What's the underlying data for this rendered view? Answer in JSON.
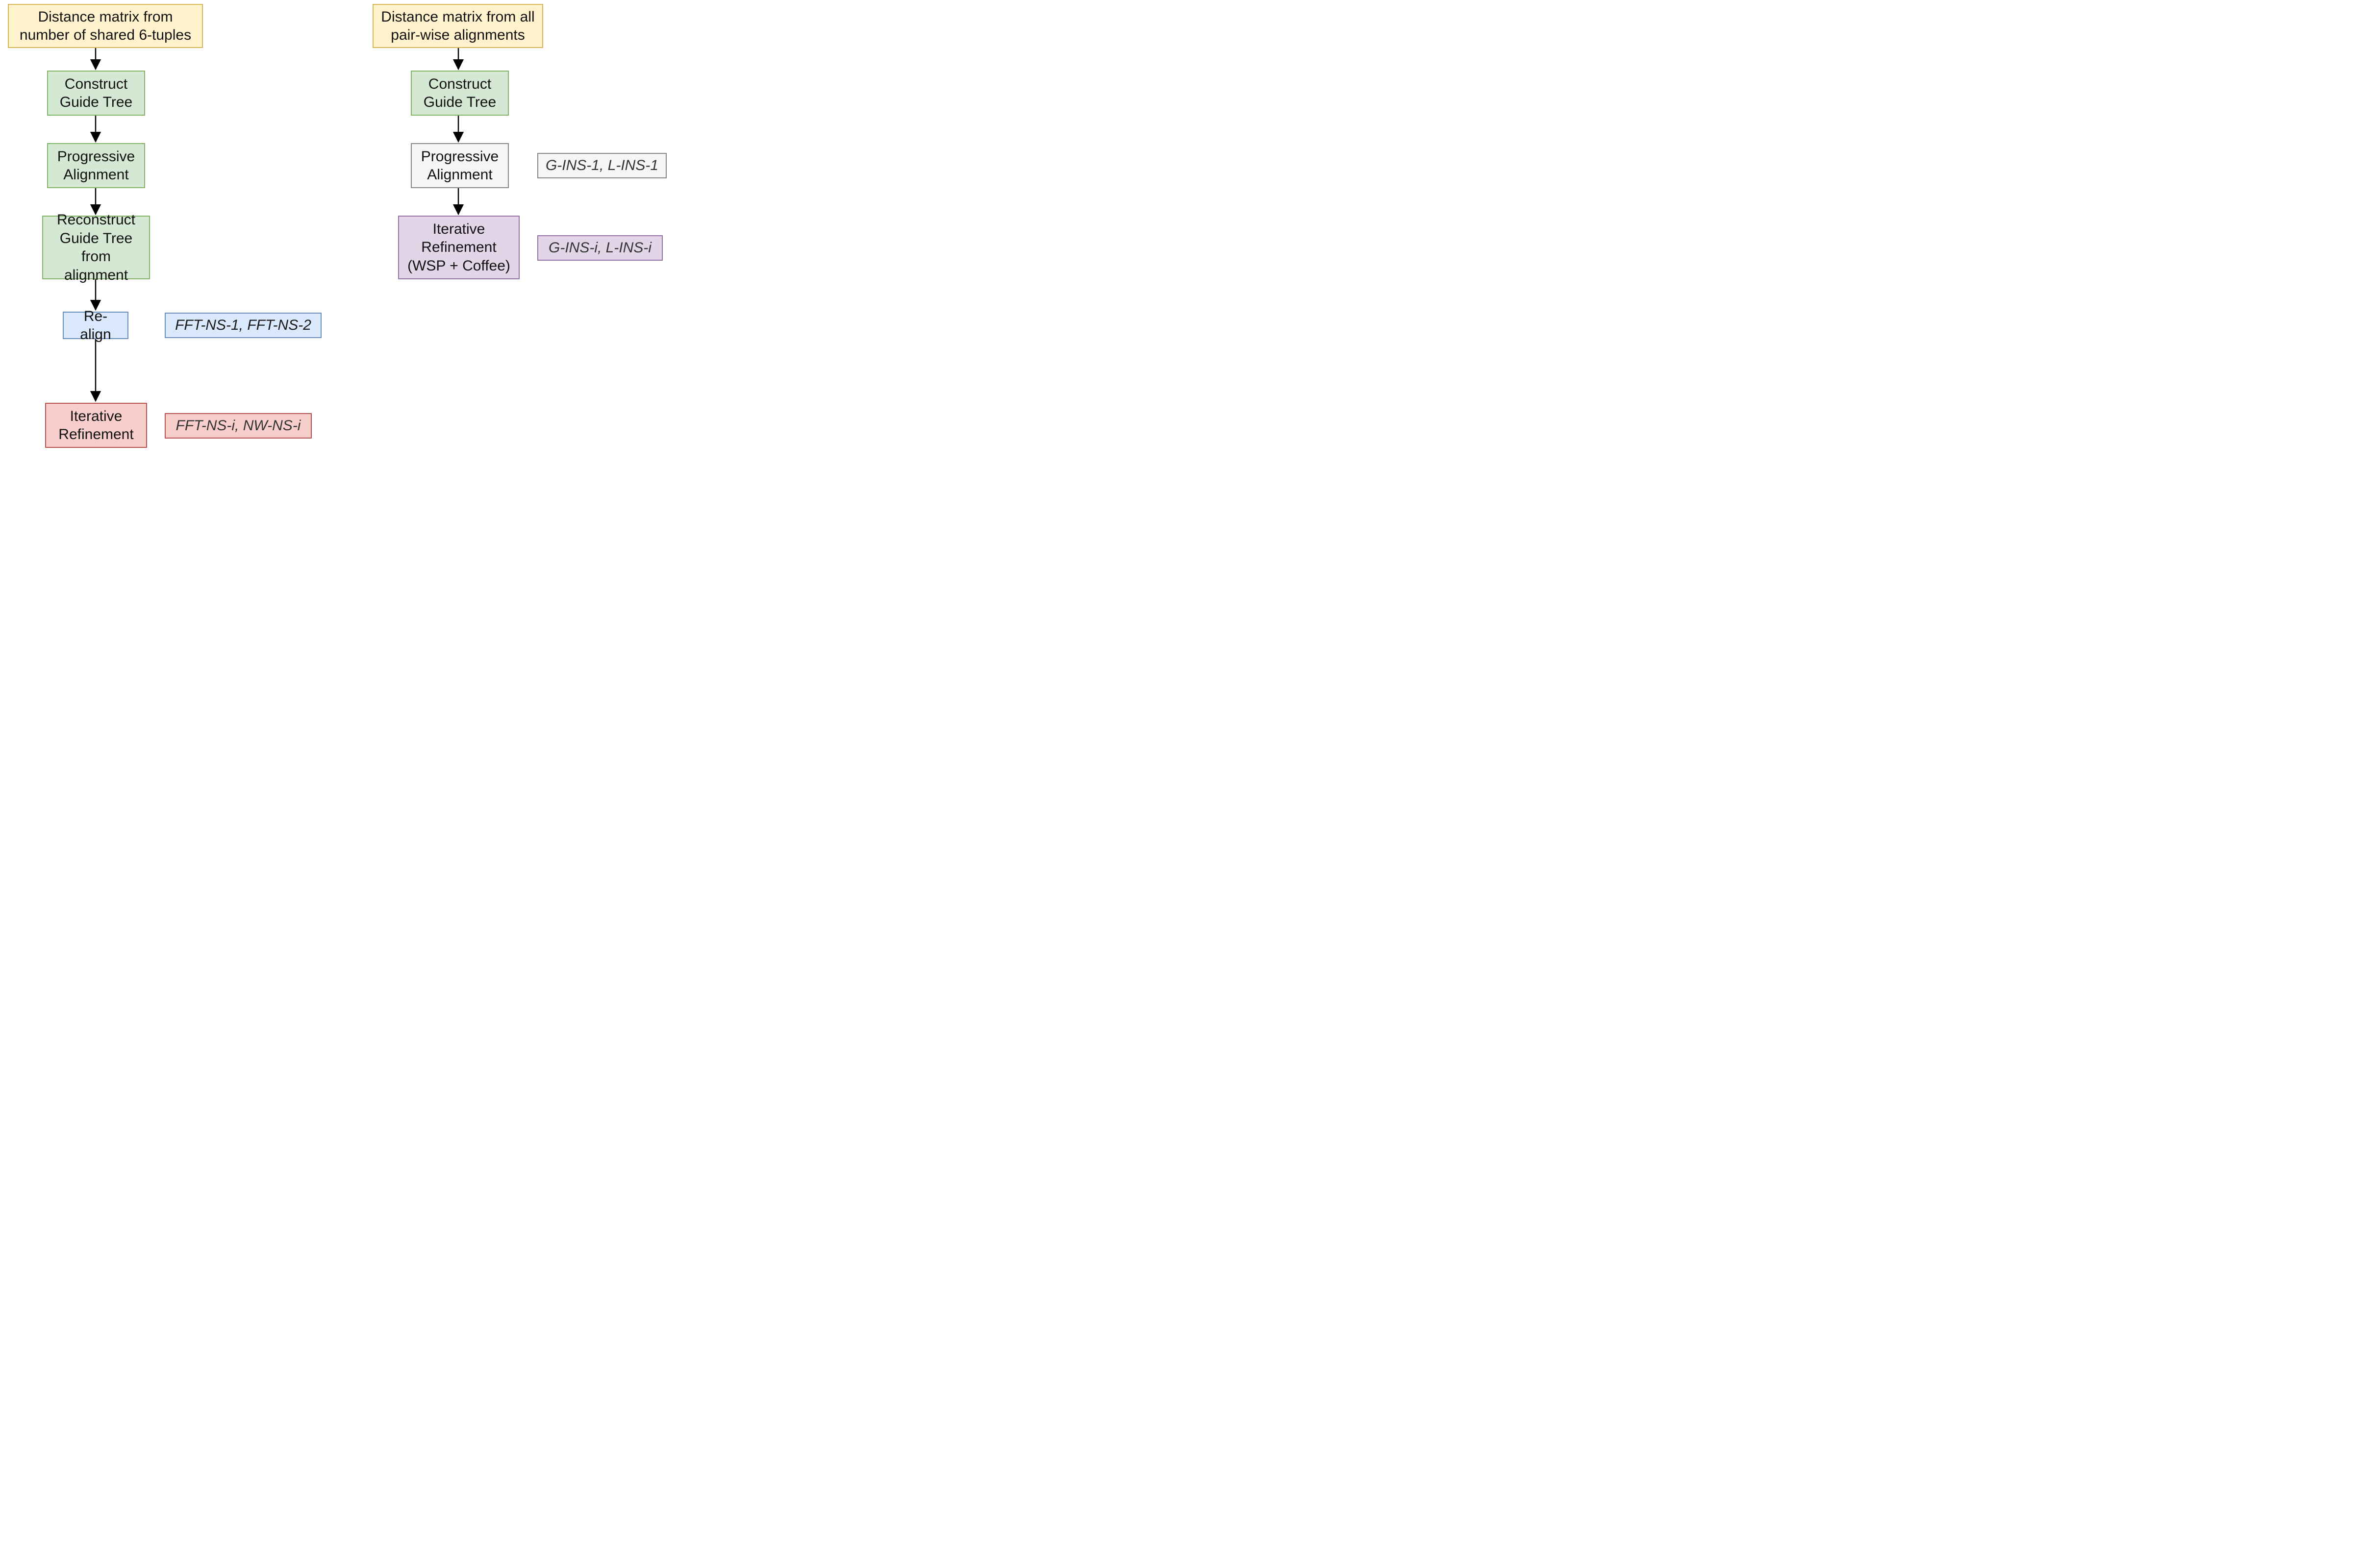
{
  "left": {
    "n1": "Distance matrix from number of shared 6-tuples",
    "n2": "Construct Guide Tree",
    "n3": "Progressive Alignment",
    "n4": "Reconstruct Guide Tree from alignment",
    "n5": "Re-align",
    "n6": "Iterative Refinement",
    "label_blue": "FFT-NS-1, FFT-NS-2",
    "label_red": "FFT-NS-i, NW-NS-i"
  },
  "right": {
    "n1": "Distance matrix from all pair-wise alignments",
    "n2": "Construct Guide Tree",
    "n3": "Progressive Alignment",
    "n4": "Iterative Refinement (WSP + Coffee)",
    "label_grey": "G-INS-1, L-INS-1",
    "label_purple": "G-INS-i, L-INS-i"
  }
}
